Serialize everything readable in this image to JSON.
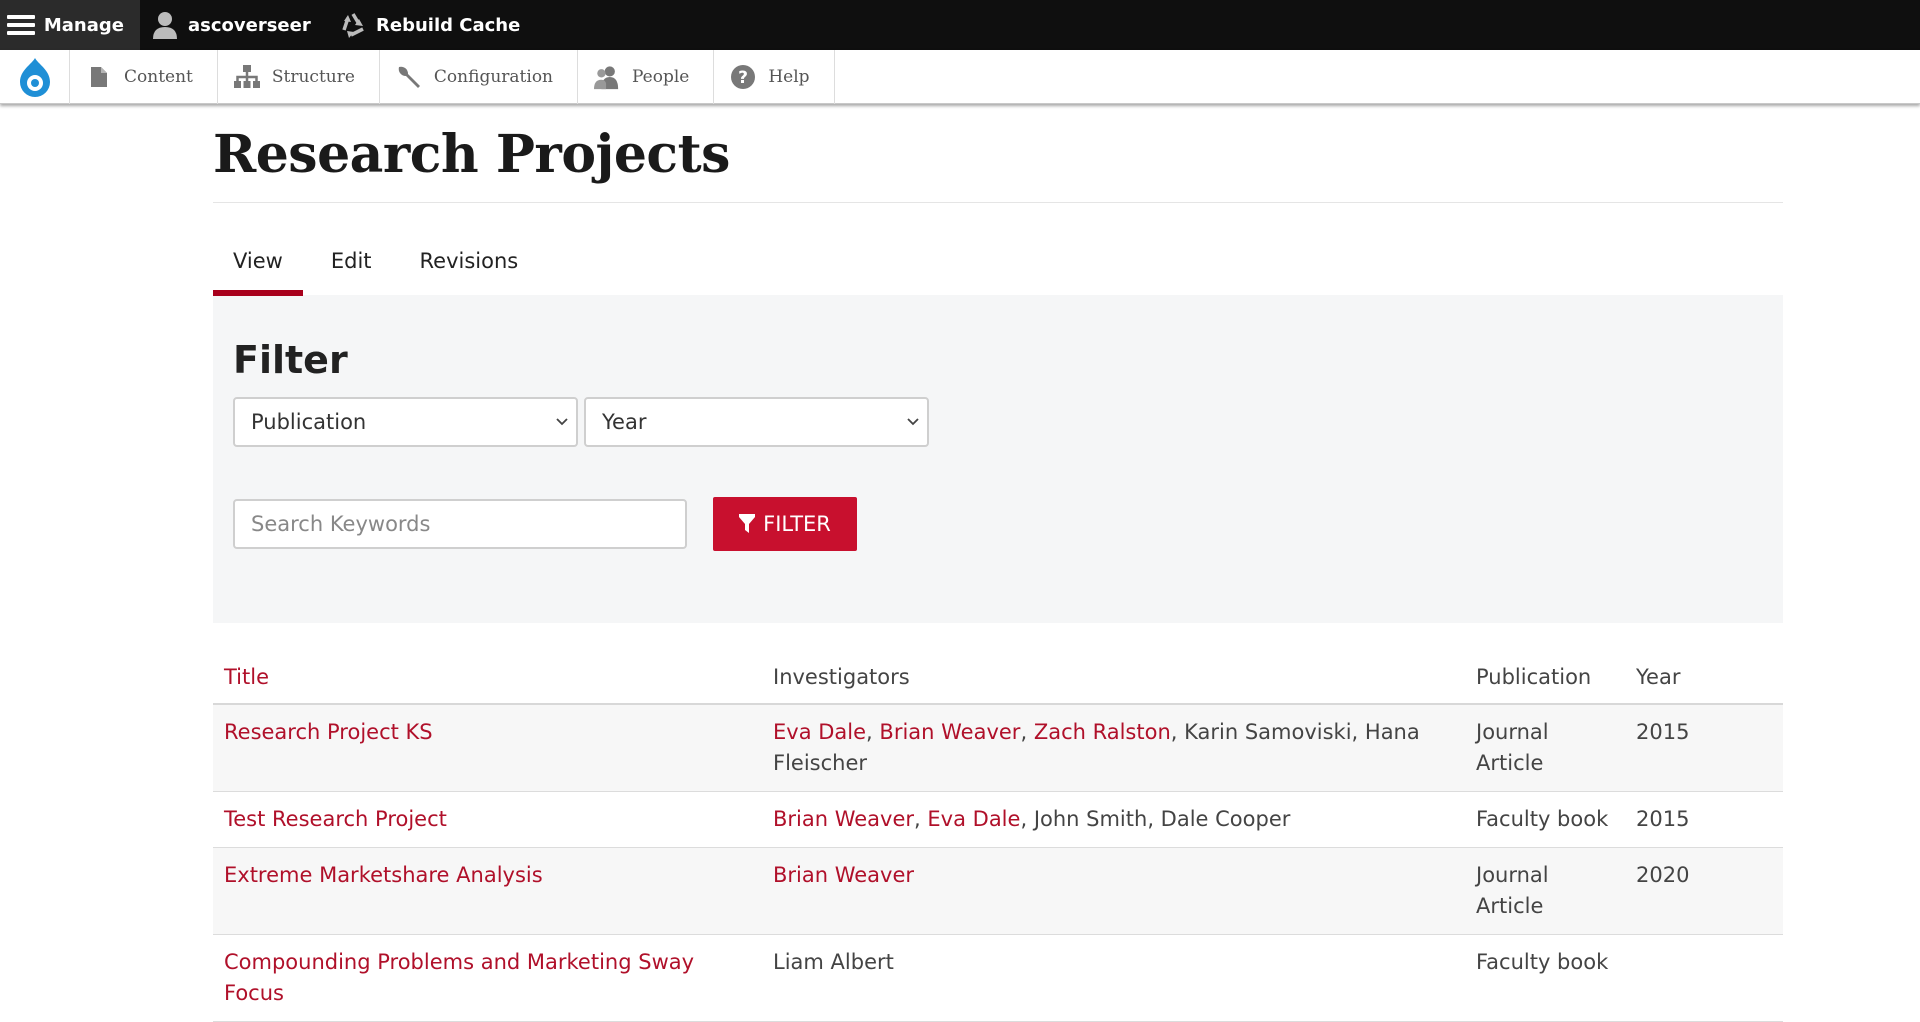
{
  "admin_bar": {
    "manage_label": "Manage",
    "user_label": "ascoverseer",
    "rebuild_label": "Rebuild Cache"
  },
  "tray": {
    "items": [
      {
        "label": "Content",
        "icon": "file-icon"
      },
      {
        "label": "Structure",
        "icon": "sitemap-icon"
      },
      {
        "label": "Configuration",
        "icon": "wrench-icon"
      },
      {
        "label": "People",
        "icon": "people-icon"
      },
      {
        "label": "Help",
        "icon": "help-icon"
      }
    ]
  },
  "page": {
    "title": "Research Projects",
    "tabs": [
      "View",
      "Edit",
      "Revisions"
    ],
    "active_tab": "View"
  },
  "filter": {
    "title": "Filter",
    "publication_select": "Publication",
    "year_select": "Year",
    "search_placeholder": "Search Keywords",
    "button_label": "FILTER"
  },
  "table": {
    "headers": [
      "Title",
      "Investigators",
      "Publication",
      "Year"
    ],
    "rows": [
      {
        "title": "Research Project KS",
        "investigators_linked": [
          "Eva Dale",
          "Brian Weaver",
          "Zach Ralston"
        ],
        "investigators_plain": "Karin Samoviski, Hana Fleischer",
        "publication": "Journal Article",
        "year": "2015"
      },
      {
        "title": "Test Research Project",
        "investigators_linked": [
          "Brian Weaver",
          "Eva Dale"
        ],
        "investigators_plain": "John Smith, Dale Cooper",
        "publication": "Faculty book",
        "year": "2015"
      },
      {
        "title": "Extreme Marketshare Analysis",
        "investigators_linked": [
          "Brian Weaver"
        ],
        "investigators_plain": "",
        "publication": "Journal Article",
        "year": "2020"
      },
      {
        "title": "Compounding Problems and Marketing Sway Focus",
        "investigators_linked": [],
        "investigators_plain": "Liam Albert",
        "publication": "Faculty book",
        "year": ""
      }
    ]
  },
  "colors": {
    "accent": "#c8102e",
    "link": "#b0102a",
    "toolbar": "#0f0f0f"
  }
}
